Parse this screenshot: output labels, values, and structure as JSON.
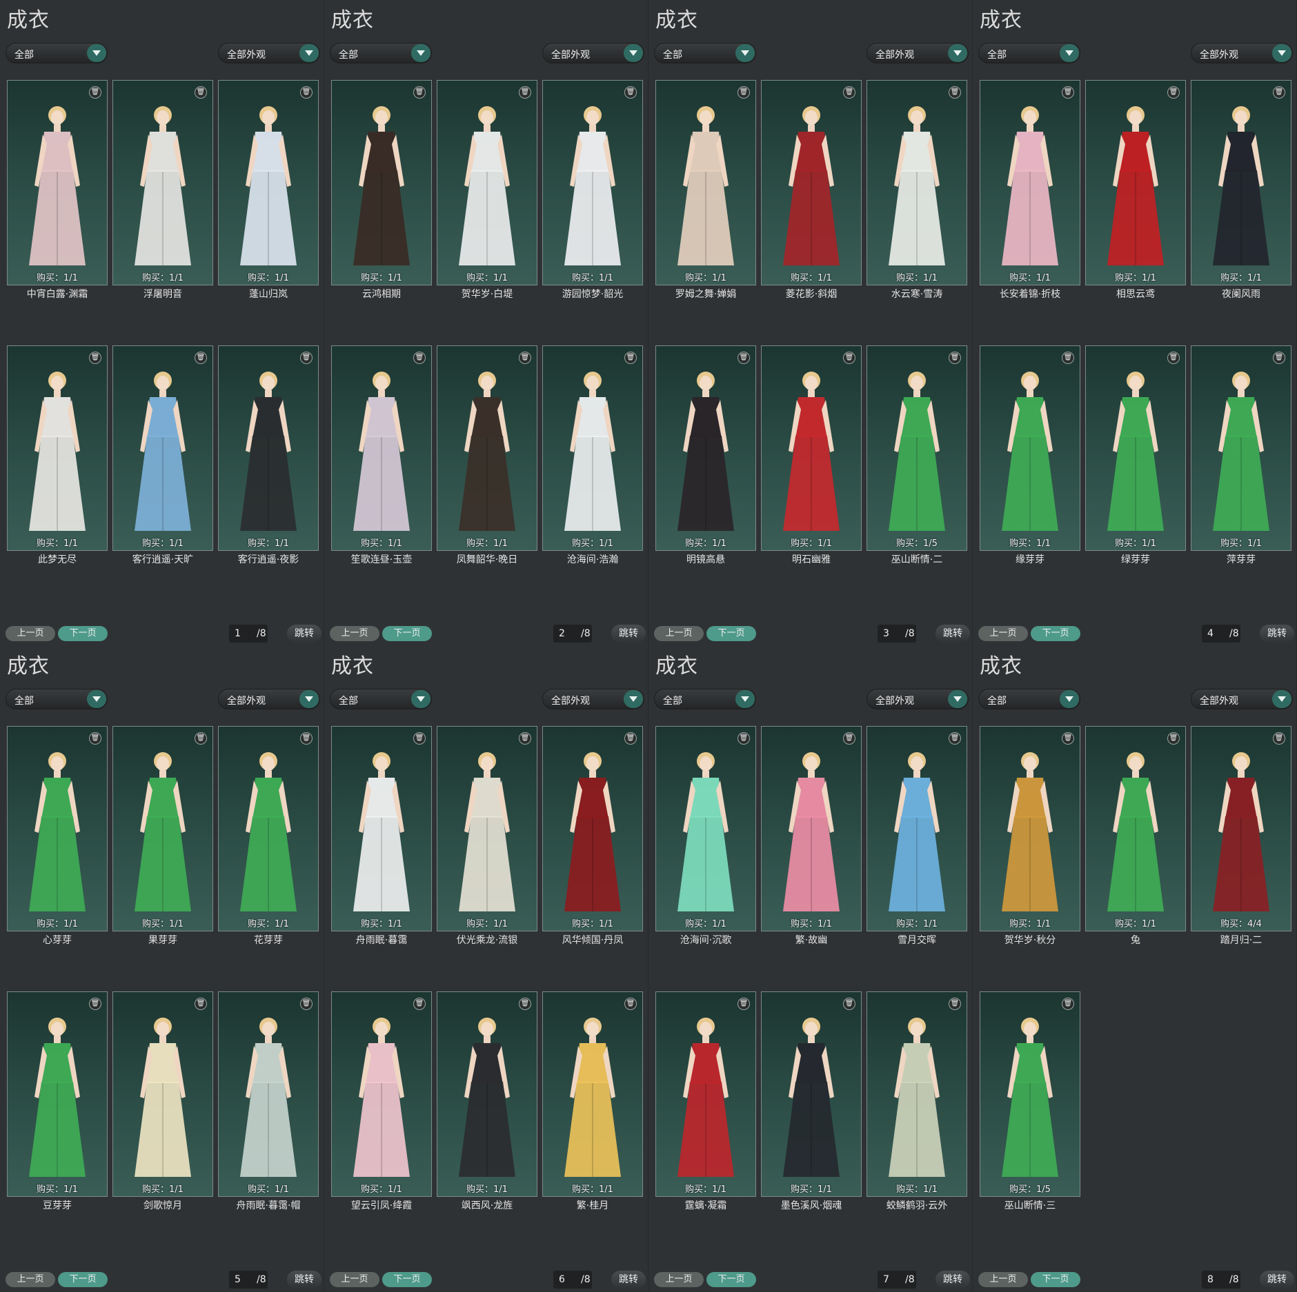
{
  "panel_title": "成衣",
  "filter_all": "全部",
  "filter_appearance": "全部外观",
  "prev_label": "上一页",
  "next_label": "下一页",
  "jump_label": "跳转",
  "total_pages": "/8",
  "pages": [
    {
      "page": "1",
      "items": [
        {
          "buy": "购买：1/1",
          "name": "中宵白露·渊霜",
          "color": "#e7c6c9"
        },
        {
          "buy": "购买：1/1",
          "name": "浮屠明音",
          "color": "#e9e8e4"
        },
        {
          "buy": "购买：1/1",
          "name": "蓬山归岚",
          "color": "#dfe7f1"
        },
        {
          "buy": "购买：1/1",
          "name": "此梦无尽",
          "color": "#eceae6"
        },
        {
          "buy": "购买：1/1",
          "name": "客行逍遥·天旷",
          "color": "#7fb3dc"
        },
        {
          "buy": "购买：1/1",
          "name": "客行逍遥·夜影",
          "color": "#2a2c2f"
        }
      ]
    },
    {
      "page": "2",
      "items": [
        {
          "buy": "购买：1/1",
          "name": "云鸿相期",
          "color": "#3a2a24"
        },
        {
          "buy": "购买：1/1",
          "name": "贺华岁·白堤",
          "color": "#eef0ef"
        },
        {
          "buy": "购买：1/1",
          "name": "游园惊梦·韶光",
          "color": "#f2f2f4"
        },
        {
          "buy": "购买：1/1",
          "name": "笙歌连昼·玉壶",
          "color": "#d9cbd9"
        },
        {
          "buy": "购买：1/1",
          "name": "凤舞韶华·晚日",
          "color": "#3b2f28"
        },
        {
          "buy": "购买：1/1",
          "name": "沧海间·浩瀚",
          "color": "#eef1f2"
        }
      ]
    },
    {
      "page": "3",
      "items": [
        {
          "buy": "购买：1/1",
          "name": "罗姆之舞·婵娟",
          "color": "#e8d2c0"
        },
        {
          "buy": "购买：1/1",
          "name": "菱花影·斜烟",
          "color": "#a52428"
        },
        {
          "buy": "购买：1/1",
          "name": "水云寒·雪涛",
          "color": "#edf0ea"
        },
        {
          "buy": "购买：1/1",
          "name": "明镜高悬",
          "color": "#2a2428"
        },
        {
          "buy": "购买：1/1",
          "name": "明石幽雅",
          "color": "#c9282c"
        },
        {
          "buy": "购买：1/5",
          "name": "巫山断情·二",
          "color": "#3fae55"
        }
      ]
    },
    {
      "page": "4",
      "items": [
        {
          "buy": "购买：1/1",
          "name": "长安着锦·折枝",
          "color": "#efb9c8"
        },
        {
          "buy": "购买：1/1",
          "name": "相思云鸢",
          "color": "#c41f22"
        },
        {
          "buy": "购买：1/1",
          "name": "夜阑风雨",
          "color": "#22242c"
        },
        {
          "buy": "购买：1/1",
          "name": "缘芽芽",
          "color": "#3fae55"
        },
        {
          "buy": "购买：1/1",
          "name": "绿芽芽",
          "color": "#3fae55"
        },
        {
          "buy": "购买：1/1",
          "name": "萍芽芽",
          "color": "#3fae55"
        }
      ]
    },
    {
      "page": "5",
      "items": [
        {
          "buy": "购买：1/1",
          "name": "心芽芽",
          "color": "#3fae55"
        },
        {
          "buy": "购买：1/1",
          "name": "果芽芽",
          "color": "#3fae55"
        },
        {
          "buy": "购买：1/1",
          "name": "花芽芽",
          "color": "#3fae55"
        },
        {
          "buy": "购买：1/1",
          "name": "豆芽芽",
          "color": "#3fae55"
        },
        {
          "buy": "购买：1/1",
          "name": "剑歌惊月",
          "color": "#f1e7c4"
        },
        {
          "buy": "购买：1/1",
          "name": "舟雨眠·暮霭·帽",
          "color": "#c9d6cf"
        }
      ]
    },
    {
      "page": "6",
      "items": [
        {
          "buy": "购买：1/1",
          "name": "舟雨眠·暮霭",
          "color": "#f1f2f2"
        },
        {
          "buy": "购买：1/1",
          "name": "伏光乘龙·流银",
          "color": "#e8e3d6"
        },
        {
          "buy": "购买：1/1",
          "name": "风华倾国·丹凤",
          "color": "#8e1b1e"
        },
        {
          "buy": "购买：1/1",
          "name": "望云引凤·绛霞",
          "color": "#f3c7d0"
        },
        {
          "buy": "购买：1/1",
          "name": "飒西风·龙旌",
          "color": "#2b2b2f"
        },
        {
          "buy": "购买：1/1",
          "name": "繁·桂月",
          "color": "#f0c45a"
        }
      ]
    },
    {
      "page": "7",
      "items": [
        {
          "buy": "购买：1/1",
          "name": "沧海间·沉歌",
          "color": "#7fe0c0"
        },
        {
          "buy": "购买：1/1",
          "name": "繁·故幽",
          "color": "#ef8ea6"
        },
        {
          "buy": "购买：1/1",
          "name": "雪月交晖",
          "color": "#6fb4e2"
        },
        {
          "buy": "购买：1/1",
          "name": "霆螭·凝霜",
          "color": "#c0262b"
        },
        {
          "buy": "购买：1/1",
          "name": "墨色溪风·烟魂",
          "color": "#25282e"
        },
        {
          "buy": "购买：1/1",
          "name": "蛟鳞鹤羽·云外",
          "color": "#cfd5bc"
        }
      ]
    },
    {
      "page": "8",
      "items": [
        {
          "buy": "购买：1/1",
          "name": "贺华岁·秋分",
          "color": "#d49a3c"
        },
        {
          "buy": "购买：1/1",
          "name": "兔",
          "color": "#3fae55"
        },
        {
          "buy": "购买：4/4",
          "name": "踏月归·二",
          "color": "#8c1f24"
        },
        {
          "buy": "购买：1/5",
          "name": "巫山断情·三",
          "color": "#3fae55"
        }
      ]
    }
  ]
}
